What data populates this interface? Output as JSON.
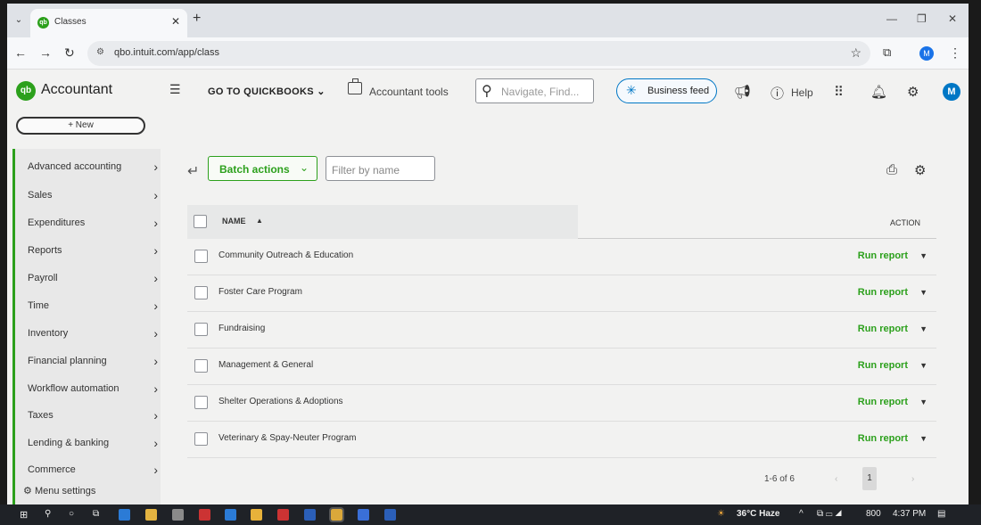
{
  "browser": {
    "tab_title": "Classes",
    "url": "qbo.intuit.com/app/class",
    "profile_initial": "M"
  },
  "header": {
    "brand": "Accountant",
    "goto": "GO TO QUICKBOOKS",
    "accountant_tools": "Accountant tools",
    "search_placeholder": "Navigate, Find...",
    "business_feed": "Business feed",
    "help": "Help",
    "avatar_initial": "M"
  },
  "sidebar": {
    "new_label": "+ New",
    "items": [
      {
        "label": "Advanced accounting"
      },
      {
        "label": "Sales"
      },
      {
        "label": "Expenditures"
      },
      {
        "label": "Reports"
      },
      {
        "label": "Payroll"
      },
      {
        "label": "Time"
      },
      {
        "label": "Inventory"
      },
      {
        "label": "Financial planning"
      },
      {
        "label": "Workflow automation"
      },
      {
        "label": "Taxes"
      },
      {
        "label": "Lending & banking"
      },
      {
        "label": "Commerce"
      }
    ],
    "menu_settings": "Menu settings"
  },
  "main": {
    "batch_actions": "Batch actions",
    "filter_placeholder": "Filter by name",
    "columns": {
      "name": "NAME",
      "action": "ACTION"
    },
    "rows": [
      {
        "name": "Community Outreach & Education",
        "action": "Run report"
      },
      {
        "name": "Foster Care Program",
        "action": "Run report"
      },
      {
        "name": "Fundraising",
        "action": "Run report"
      },
      {
        "name": "Management & General",
        "action": "Run report"
      },
      {
        "name": "Shelter Operations & Adoptions",
        "action": "Run report"
      },
      {
        "name": "Veterinary & Spay-Neuter Program",
        "action": "Run report"
      }
    ],
    "pagination": {
      "range": "1-6 of 6",
      "current_page": "1"
    }
  },
  "taskbar": {
    "weather": "36°C Haze",
    "clock": "4:37 PM",
    "tray_text": "800"
  },
  "colors": {
    "accent": "#2ca01c",
    "link_blue": "#0077c5"
  }
}
